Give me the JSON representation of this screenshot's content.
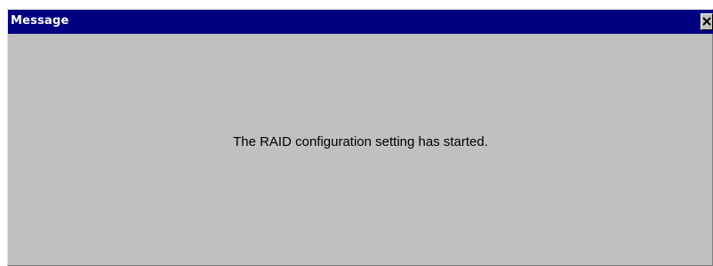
{
  "window": {
    "title": "Message",
    "close_icon": "close-icon",
    "titlebar_color": "#000080",
    "background_color": "#c0c0c0"
  },
  "body": {
    "message": "The RAID configuration setting has started."
  }
}
